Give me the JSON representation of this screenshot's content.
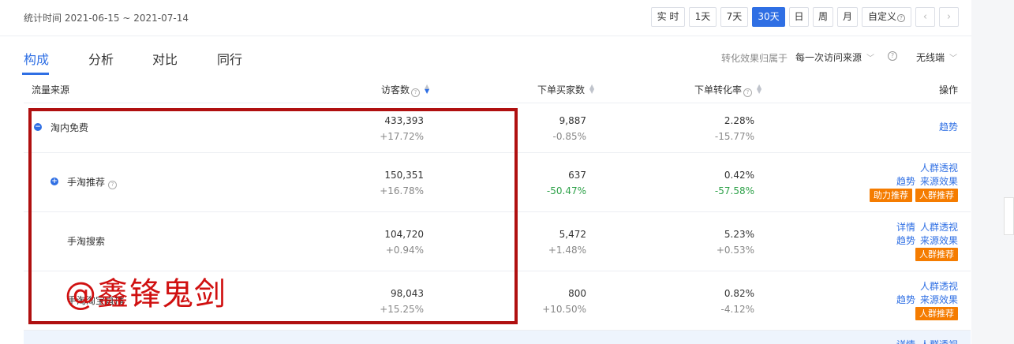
{
  "date_range": "统计时间 2021-06-15 ~ 2021-07-14",
  "periods": [
    "实 时",
    "1天",
    "7天",
    "30天",
    "日",
    "周",
    "月"
  ],
  "active_period": "30天",
  "custom_label": "自定义",
  "nav": {
    "prev": "‹",
    "next": "›"
  },
  "tabs": [
    "构成",
    "分析",
    "对比",
    "同行"
  ],
  "active_tab": "构成",
  "attribution": {
    "label": "转化效果归属于",
    "value": "每一次访问来源"
  },
  "device": "无线端",
  "columns": {
    "source": "流量来源",
    "visitors": "访客数",
    "buyers": "下单买家数",
    "rate": "下单转化率",
    "ops": "操作"
  },
  "rows": [
    {
      "source": "淘内免费",
      "visitors": "433,393",
      "visitors_change": "+17.72%",
      "buyers": "9,887",
      "buyers_change": "-0.85%",
      "rate": "2.28%",
      "rate_change": "-15.77%"
    },
    {
      "source": "手淘推荐",
      "visitors": "150,351",
      "visitors_change": "+16.78%",
      "buyers": "637",
      "buyers_change": "-50.47%",
      "rate": "0.42%",
      "rate_change": "-57.58%"
    },
    {
      "source": "手淘搜索",
      "visitors": "104,720",
      "visitors_change": "+0.94%",
      "buyers": "5,472",
      "buyers_change": "+1.48%",
      "rate": "5.23%",
      "rate_change": "+0.53%"
    },
    {
      "source": "手淘淘宝直播",
      "visitors": "98,043",
      "visitors_change": "+15.25%",
      "buyers": "800",
      "buyers_change": "+10.50%",
      "rate": "0.82%",
      "rate_change": "-4.12%"
    }
  ],
  "ops": {
    "trend": "趋势",
    "crowd": "人群透视",
    "effect": "来源效果",
    "detail": "详情",
    "boost_tag": "助力推荐",
    "crowd_tag": "人群推荐"
  },
  "watermark": "@鑫锋鬼剑"
}
